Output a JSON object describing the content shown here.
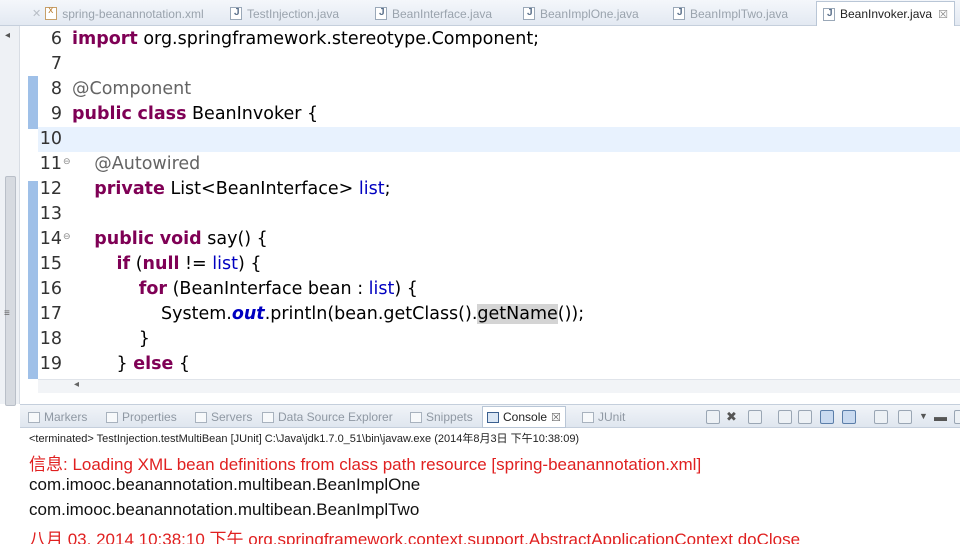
{
  "editor_tabs": [
    {
      "label": "spring-beanannotation.xml",
      "type": "xml",
      "active": false
    },
    {
      "label": "TestInjection.java",
      "type": "java",
      "active": false
    },
    {
      "label": "BeanInterface.java",
      "type": "java",
      "active": false
    },
    {
      "label": "BeanImplOne.java",
      "type": "java",
      "active": false
    },
    {
      "label": "BeanImplTwo.java",
      "type": "java",
      "active": false
    },
    {
      "label": "BeanInvoker.java",
      "type": "java",
      "active": true,
      "close": "☒"
    }
  ],
  "code_lines": [
    {
      "num": "6",
      "tokens": [
        [
          "kw",
          "import"
        ],
        [
          "p",
          " org.springframework.stereotype.Component;"
        ]
      ]
    },
    {
      "num": "7",
      "tokens": []
    },
    {
      "num": "8",
      "tokens": [
        [
          "ann",
          "@Component"
        ]
      ]
    },
    {
      "num": "9",
      "tokens": [
        [
          "kw",
          "public"
        ],
        [
          "p",
          " "
        ],
        [
          "kw",
          "class"
        ],
        [
          "p",
          " BeanInvoker {"
        ]
      ]
    },
    {
      "num": "10",
      "tokens": [],
      "current": true
    },
    {
      "num": "11",
      "fold": true,
      "tokens": [
        [
          "p",
          "    "
        ],
        [
          "ann",
          "@Autowired"
        ]
      ]
    },
    {
      "num": "12",
      "tokens": [
        [
          "p",
          "    "
        ],
        [
          "kw",
          "private"
        ],
        [
          "p",
          " List<BeanInterface> "
        ],
        [
          "fld",
          "list"
        ],
        [
          "p",
          ";"
        ]
      ]
    },
    {
      "num": "13",
      "tokens": []
    },
    {
      "num": "14",
      "fold": true,
      "tokens": [
        [
          "p",
          "    "
        ],
        [
          "kw",
          "public"
        ],
        [
          "p",
          " "
        ],
        [
          "kw",
          "void"
        ],
        [
          "p",
          " say() {"
        ]
      ]
    },
    {
      "num": "15",
      "tokens": [
        [
          "p",
          "        "
        ],
        [
          "kw",
          "if"
        ],
        [
          "p",
          " ("
        ],
        [
          "kw",
          "null"
        ],
        [
          "p",
          " != "
        ],
        [
          "fld",
          "list"
        ],
        [
          "p",
          ") {"
        ]
      ]
    },
    {
      "num": "16",
      "tokens": [
        [
          "p",
          "            "
        ],
        [
          "kw",
          "for"
        ],
        [
          "p",
          " (BeanInterface bean : "
        ],
        [
          "fld",
          "list"
        ],
        [
          "p",
          ") {"
        ]
      ]
    },
    {
      "num": "17",
      "tokens": [
        [
          "p",
          "                System."
        ],
        [
          "sfld",
          "out"
        ],
        [
          "p",
          ".println(bean.getClass()."
        ],
        [
          "hl",
          "getName"
        ],
        [
          "p",
          "());"
        ]
      ]
    },
    {
      "num": "18",
      "tokens": [
        [
          "p",
          "            }"
        ]
      ]
    },
    {
      "num": "19",
      "tokens": [
        [
          "p",
          "        } "
        ],
        [
          "kw",
          "else"
        ],
        [
          "p",
          " {"
        ]
      ]
    }
  ],
  "view_tabs": [
    {
      "label": "Markers",
      "active": false
    },
    {
      "label": "Properties",
      "active": false
    },
    {
      "label": "Servers",
      "active": false
    },
    {
      "label": "Data Source Explorer",
      "active": false
    },
    {
      "label": "Snippets",
      "active": false
    },
    {
      "label": "Console",
      "active": true,
      "close": "☒"
    },
    {
      "label": "JUnit",
      "active": false
    }
  ],
  "console": {
    "status": "<terminated> TestInjection.testMultiBean [JUnit] C:\\Java\\jdk1.7.0_51\\bin\\javaw.exe (2014年8月3日 下午10:38:09)",
    "lines": [
      {
        "text": "信息: Loading XML bean definitions from class path resource [spring-beanannotation.xml]",
        "kind": "err"
      },
      {
        "text": "com.imooc.beanannotation.multibean.BeanImplOne",
        "kind": "out"
      },
      {
        "text": "com.imooc.beanannotation.multibean.BeanImplTwo",
        "kind": "out"
      },
      {
        "text": "八月 03, 2014 10:38:10 下午 org.springframework.context.support.AbstractApplicationContext doClose",
        "kind": "err"
      }
    ]
  },
  "icons": {
    "tab_java": "java-file-icon",
    "tab_xml": "xml-file-icon",
    "fold": "fold-toggle-icon"
  },
  "colors": {
    "keyword": "#7f0055",
    "annotation": "#646464",
    "field": "#0000c0",
    "stderr": "#e02020",
    "current_line": "#e8f2fe"
  }
}
